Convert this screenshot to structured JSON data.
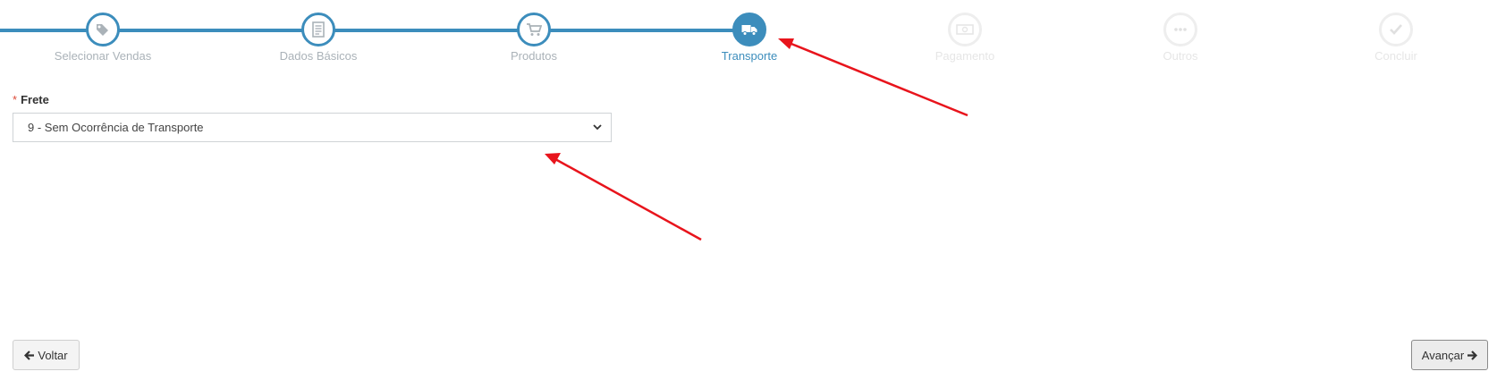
{
  "wizard": {
    "steps": [
      {
        "label": "Selecionar Vendas",
        "icon": "tags-icon",
        "state": "done"
      },
      {
        "label": "Dados Básicos",
        "icon": "document-icon",
        "state": "done"
      },
      {
        "label": "Produtos",
        "icon": "cart-icon",
        "state": "done"
      },
      {
        "label": "Transporte",
        "icon": "truck-icon",
        "state": "active"
      },
      {
        "label": "Pagamento",
        "icon": "money-icon",
        "state": "todo"
      },
      {
        "label": "Outros",
        "icon": "ellipsis-icon",
        "state": "todo"
      },
      {
        "label": "Concluir",
        "icon": "check-icon",
        "state": "todo"
      }
    ]
  },
  "form": {
    "frete": {
      "required_marker": "*",
      "label": "Frete",
      "selected": "9 - Sem Ocorrência de Transporte"
    }
  },
  "buttons": {
    "back": "Voltar",
    "next": "Avançar"
  },
  "colors": {
    "primary": "#3c8dbc",
    "annotation_arrow": "#e8141c"
  }
}
